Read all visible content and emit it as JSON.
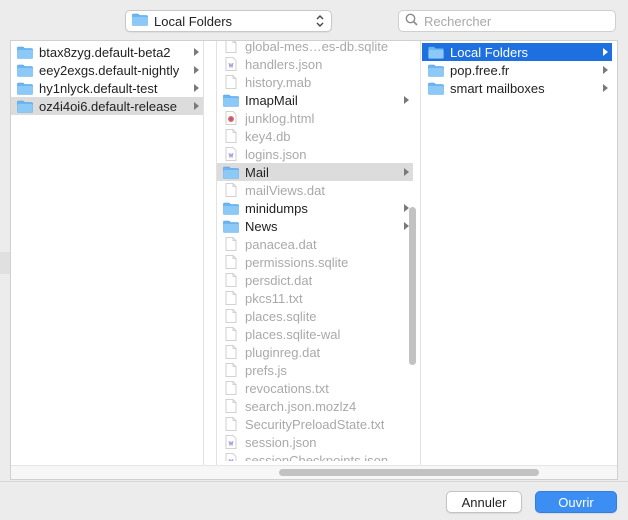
{
  "toolbar": {
    "location_label": "Local Folders",
    "search_placeholder": "Rechercher"
  },
  "columns": {
    "profiles": [
      {
        "name": "btax8zyg.default-beta2",
        "kind": "folder",
        "state": "normal",
        "arrow": true
      },
      {
        "name": "eey2exgs.default-nightly",
        "kind": "folder",
        "state": "normal",
        "arrow": true
      },
      {
        "name": "hy1nlyck.default-test",
        "kind": "folder",
        "state": "normal",
        "arrow": true
      },
      {
        "name": "oz4i4oi6.default-release",
        "kind": "folder",
        "state": "selected-gray",
        "arrow": true
      }
    ],
    "files": [
      {
        "name": "global-mes…es-db.sqlite",
        "kind": "file",
        "state": "dim",
        "arrow": false
      },
      {
        "name": "handlers.json",
        "kind": "json-file",
        "state": "dim",
        "arrow": false
      },
      {
        "name": "history.mab",
        "kind": "file",
        "state": "dim",
        "arrow": false
      },
      {
        "name": "ImapMail",
        "kind": "folder",
        "state": "normal",
        "arrow": true
      },
      {
        "name": "junklog.html",
        "kind": "html-file",
        "state": "dim",
        "arrow": false
      },
      {
        "name": "key4.db",
        "kind": "file",
        "state": "dim",
        "arrow": false
      },
      {
        "name": "logins.json",
        "kind": "json-file",
        "state": "dim",
        "arrow": false
      },
      {
        "name": "Mail",
        "kind": "folder",
        "state": "selected-gray",
        "arrow": true
      },
      {
        "name": "mailViews.dat",
        "kind": "file",
        "state": "dim",
        "arrow": false
      },
      {
        "name": "minidumps",
        "kind": "folder",
        "state": "normal",
        "arrow": true
      },
      {
        "name": "News",
        "kind": "folder",
        "state": "normal",
        "arrow": true
      },
      {
        "name": "panacea.dat",
        "kind": "file",
        "state": "dim",
        "arrow": false
      },
      {
        "name": "permissions.sqlite",
        "kind": "file",
        "state": "dim",
        "arrow": false
      },
      {
        "name": "persdict.dat",
        "kind": "file",
        "state": "dim",
        "arrow": false
      },
      {
        "name": "pkcs11.txt",
        "kind": "file",
        "state": "dim",
        "arrow": false
      },
      {
        "name": "places.sqlite",
        "kind": "file",
        "state": "dim",
        "arrow": false
      },
      {
        "name": "places.sqlite-wal",
        "kind": "file",
        "state": "dim",
        "arrow": false
      },
      {
        "name": "pluginreg.dat",
        "kind": "file",
        "state": "dim",
        "arrow": false
      },
      {
        "name": "prefs.js",
        "kind": "file",
        "state": "dim",
        "arrow": false
      },
      {
        "name": "revocations.txt",
        "kind": "file",
        "state": "dim",
        "arrow": false
      },
      {
        "name": "search.json.mozlz4",
        "kind": "file",
        "state": "dim",
        "arrow": false
      },
      {
        "name": "SecurityPreloadState.txt",
        "kind": "file",
        "state": "dim",
        "arrow": false
      },
      {
        "name": "session.json",
        "kind": "json-file",
        "state": "dim",
        "arrow": false
      },
      {
        "name": "sessionCheckpoints.json",
        "kind": "json-file",
        "state": "dim",
        "arrow": false
      }
    ],
    "mail": [
      {
        "name": "Local Folders",
        "kind": "folder",
        "state": "selected-blue",
        "arrow": true
      },
      {
        "name": "pop.free.fr",
        "kind": "folder",
        "state": "normal",
        "arrow": true
      },
      {
        "name": "smart mailboxes",
        "kind": "folder",
        "state": "normal",
        "arrow": true
      }
    ]
  },
  "footer": {
    "cancel_label": "Annuler",
    "open_label": "Ouvrir"
  },
  "colors": {
    "selection_blue": "#1e6fe0",
    "selection_gray": "#dcdcdc",
    "folder_blue": "#6bb6f2",
    "primary_button": "#3c8ef3"
  }
}
